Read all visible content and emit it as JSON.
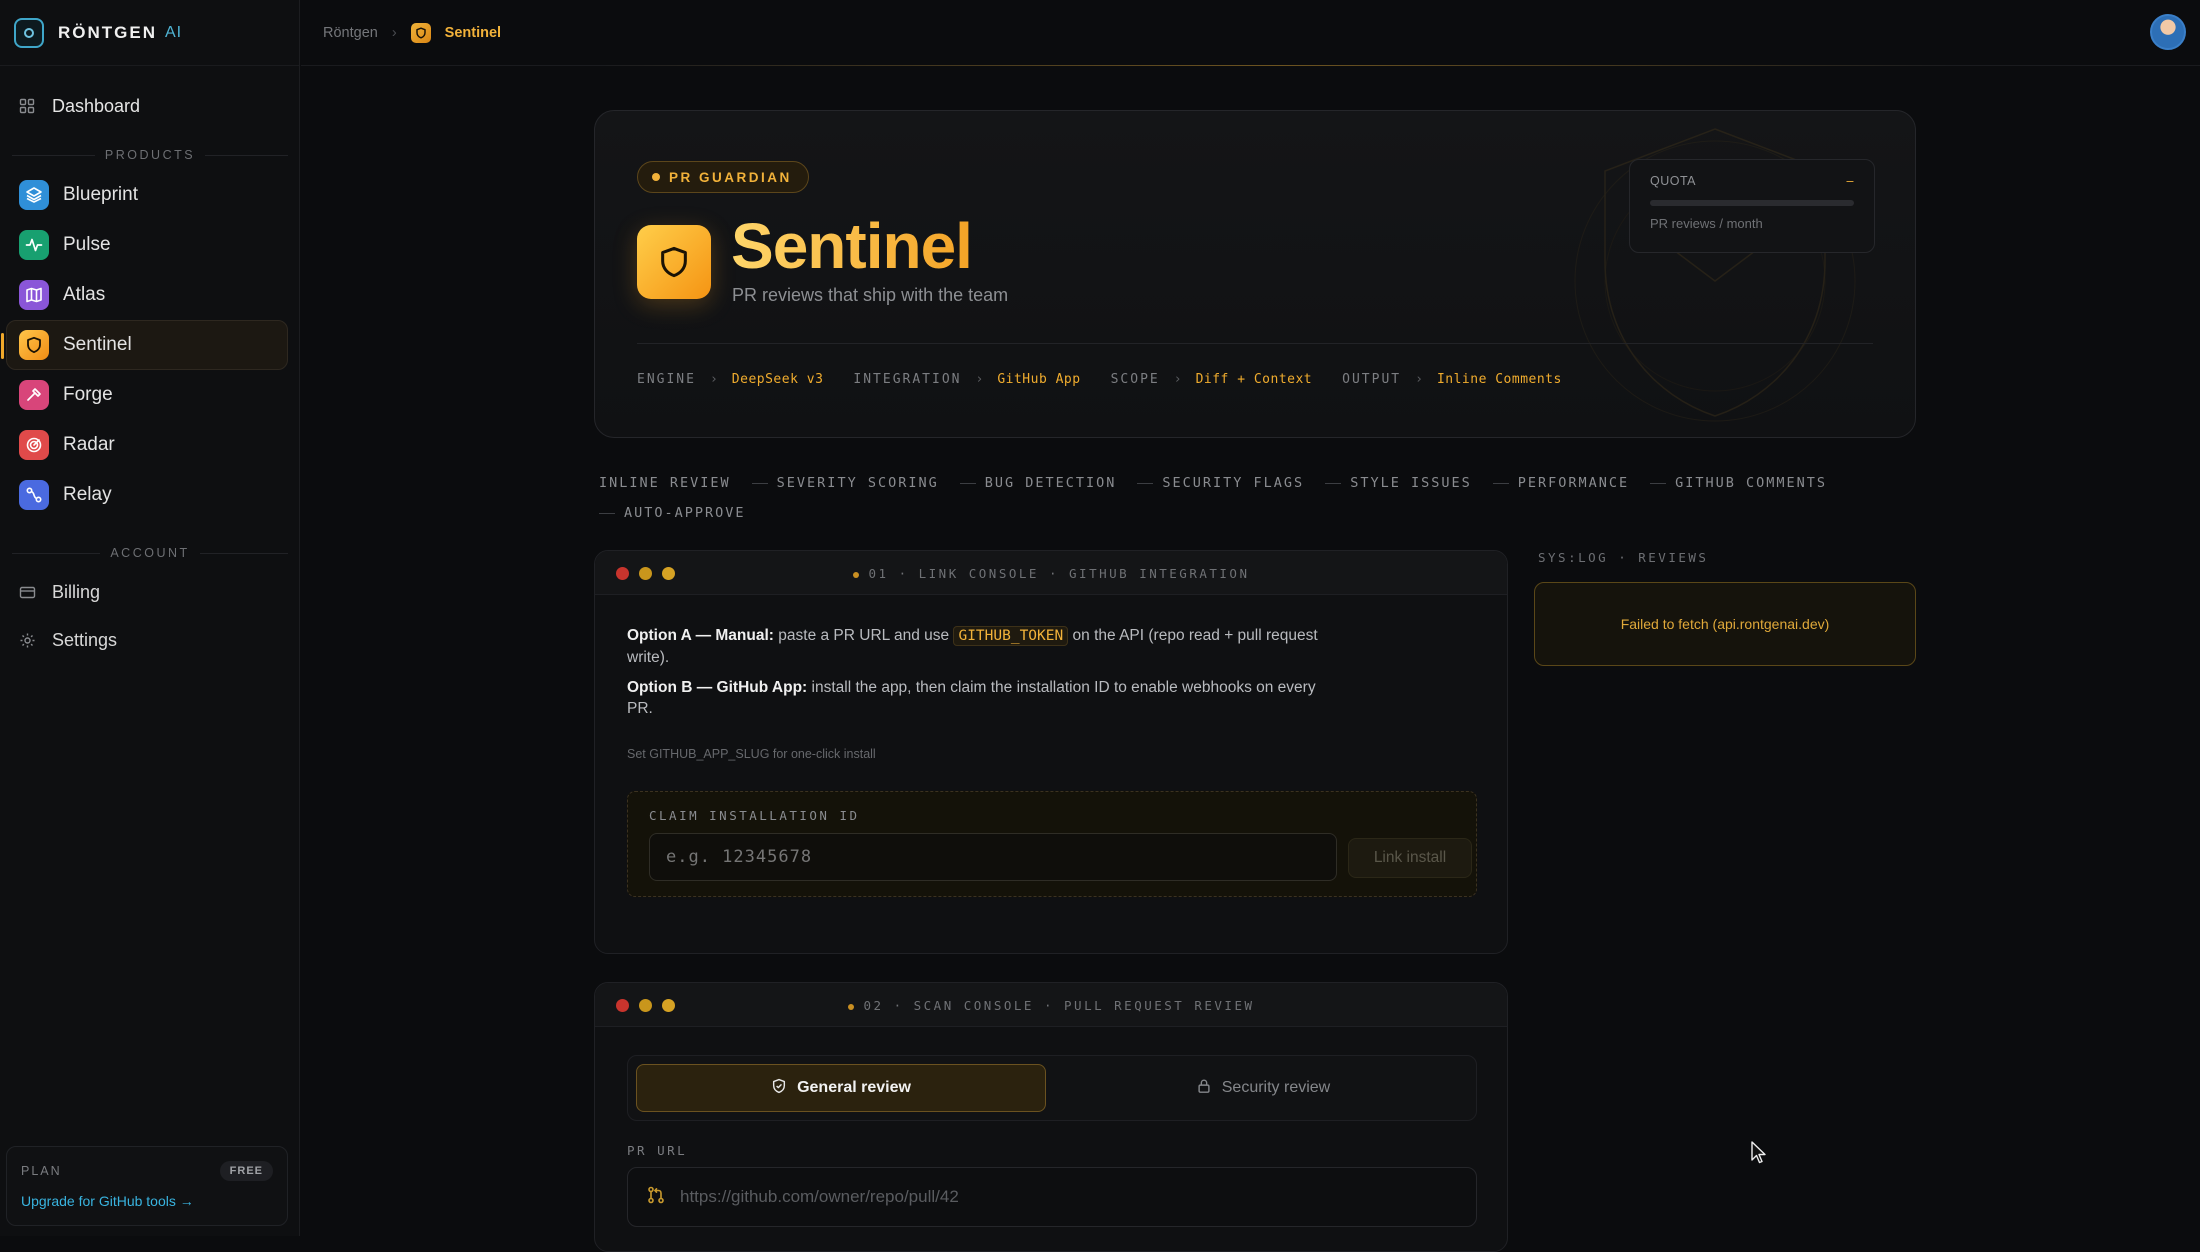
{
  "brand": {
    "name": "RÖNTGEN",
    "suffix": "AI"
  },
  "sidebar": {
    "dashboard": "Dashboard",
    "products_label": "PRODUCTS",
    "products": [
      {
        "label": "Blueprint",
        "icon": "layers-icon",
        "color": "#2f8fd8"
      },
      {
        "label": "Pulse",
        "icon": "activity-icon",
        "color": "#18a070"
      },
      {
        "label": "Atlas",
        "icon": "map-icon",
        "color": "#8a56d8"
      },
      {
        "label": "Sentinel",
        "icon": "shield-icon",
        "color": "#f2a326"
      },
      {
        "label": "Forge",
        "icon": "hammer-icon",
        "color": "#d8457a"
      },
      {
        "label": "Radar",
        "icon": "radar-icon",
        "color": "#e04a4a"
      },
      {
        "label": "Relay",
        "icon": "route-icon",
        "color": "#4a6ae0"
      }
    ],
    "account_label": "ACCOUNT",
    "billing": "Billing",
    "settings": "Settings",
    "plan": {
      "label": "PLAN",
      "badge": "FREE",
      "link": "Upgrade for GitHub tools →"
    }
  },
  "topbar": {
    "root": "Röntgen",
    "current": "Sentinel"
  },
  "hero": {
    "pill": "PR GUARDIAN",
    "title": "Sentinel",
    "subtitle": "PR reviews that ship with the team",
    "meta": [
      {
        "key": "ENGINE",
        "value": "DeepSeek v3"
      },
      {
        "key": "INTEGRATION",
        "value": "GitHub App"
      },
      {
        "key": "SCOPE",
        "value": "Diff + Context"
      },
      {
        "key": "OUTPUT",
        "value": "Inline Comments"
      }
    ],
    "quota": {
      "label": "QUOTA",
      "value": "–",
      "caption": "PR reviews / month",
      "used_fraction": 0
    }
  },
  "features": [
    "INLINE REVIEW",
    "SEVERITY SCORING",
    "BUG DETECTION",
    "SECURITY FLAGS",
    "STYLE ISSUES",
    "PERFORMANCE",
    "GITHUB COMMENTS",
    "AUTO-APPROVE"
  ],
  "link_console": {
    "title": "01 · LINK CONSOLE · GITHUB INTEGRATION",
    "option_a_title": "Option A — Manual:",
    "option_a_pre": "paste a PR URL and use",
    "option_a_code": "GITHUB_TOKEN",
    "option_a_post": "on the API (repo read + pull request write).",
    "option_b_title": "Option B — GitHub App:",
    "option_b_text": "install the app, then claim the installation ID to enable webhooks on every PR.",
    "hint": "Set GITHUB_APP_SLUG for one-click install",
    "claim_label": "CLAIM INSTALLATION ID",
    "claim_placeholder": "e.g. 12345678",
    "claim_button": "Link install"
  },
  "scan_console": {
    "title": "02 · SCAN CONSOLE · PULL REQUEST REVIEW",
    "tab_general": "General review",
    "tab_security": "Security review",
    "pr_label": "PR URL",
    "pr_placeholder": "https://github.com/owner/repo/pull/42"
  },
  "log": {
    "label": "SYS:LOG · REVIEWS",
    "message": "Failed to fetch (api.rontgenai.dev)"
  },
  "colors": {
    "accent": "#f2b23a",
    "background": "#0b0c0e",
    "link": "#39b4e0"
  }
}
